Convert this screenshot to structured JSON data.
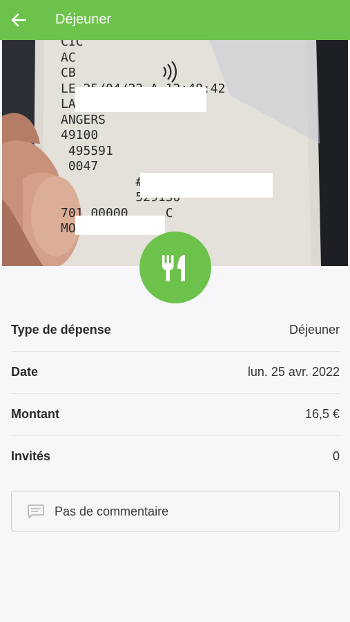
{
  "header": {
    "title": "Déjeuner",
    "back_icon": "arrow-left-icon",
    "color": "#6dc24b"
  },
  "receipt_photo": {
    "lines": [
      "CIC",
      "",
      "",
      "AC",
      "CB",
      "LE 25/04/22 A 12:48:42",
      "LA FAMILY",
      "ANGERS",
      "49100",
      " 495591",
      " 0047",
      "          ##3915",
      "          529130",
      "701 00000     C",
      "MONTANT"
    ]
  },
  "category_icon": "fork-knife-icon",
  "details": [
    {
      "label": "Type de dépense",
      "value": "Déjeuner"
    },
    {
      "label": "Date",
      "value": "lun. 25 avr. 2022"
    },
    {
      "label": "Montant",
      "value": "16,5 €"
    },
    {
      "label": "Invités",
      "value": "0"
    }
  ],
  "comment": {
    "text": "Pas de commentaire",
    "icon": "comment-icon"
  }
}
